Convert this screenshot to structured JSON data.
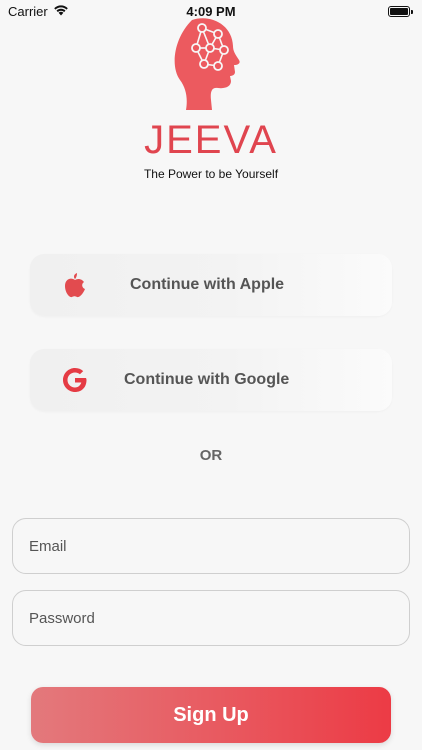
{
  "status_bar": {
    "carrier": "Carrier",
    "time": "4:09 PM",
    "icons": [
      "wifi-icon",
      "battery-icon"
    ]
  },
  "brand": {
    "name": "JEEVA",
    "tagline": "The Power to be Yourself",
    "logo_icon": "head-network-logo",
    "accent_color": "#e0454f"
  },
  "social": {
    "apple_label": "Continue with Apple",
    "apple_icon": "apple-icon",
    "google_label": "Continue with Google",
    "google_icon": "google-icon"
  },
  "divider_text": "OR",
  "form": {
    "email_placeholder": "Email",
    "password_placeholder": "Password",
    "email_value": "",
    "password_value": ""
  },
  "signup_label": "Sign Up",
  "colors": {
    "signup_gradient_start": "#e3797c",
    "signup_gradient_end": "#ec3b45",
    "background": "#f7f7f7"
  }
}
